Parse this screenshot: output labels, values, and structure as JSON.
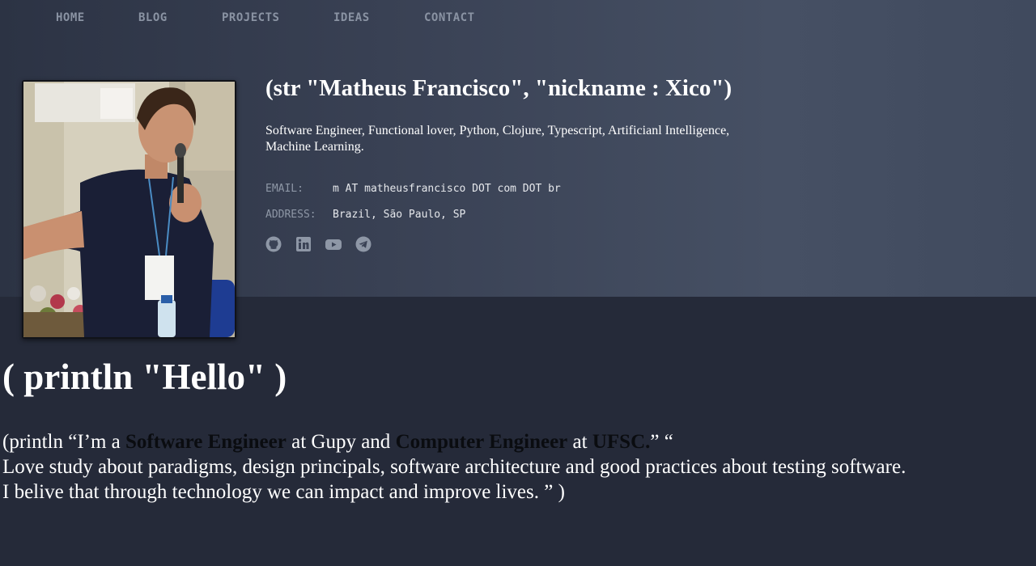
{
  "nav": {
    "items": [
      {
        "label": "HOME"
      },
      {
        "label": "BLOG"
      },
      {
        "label": "PROJECTS"
      },
      {
        "label": "IDEAS"
      },
      {
        "label": "CONTACT"
      }
    ]
  },
  "profile": {
    "name": "(str \"Matheus Francisco\", \"nickname : Xico\")",
    "tagline": "Software Engineer, Functional lover, Python, Clojure, Typescript, Artificianl Intelligence, Machine Learning.",
    "email_label": "EMAIL:",
    "email_value": "m AT matheusfrancisco DOT com DOT br",
    "address_label": "ADDRESS:",
    "address_value": "Brazil, São Paulo, SP",
    "social_icons": [
      "github-icon",
      "linkedin-icon",
      "youtube-icon",
      "telegram-icon"
    ]
  },
  "about": {
    "title": "( println \"Hello\" )",
    "line1_a": "(println “I’m a ",
    "line1_b": "Software Engineer",
    "line1_c": " at Gupy and ",
    "line1_d": "Computer Engineer",
    "line1_e": " at ",
    "line1_f": "UFSC.",
    "line1_g": "” “",
    "line2": "Love study about paradigms, design principals, software architecture and good practices about testing software.",
    "line3": "I belive that through technology we can impact and improve lives. ” )"
  },
  "colors": {
    "hero_bg": "#3a4255",
    "page_bg": "#252a39",
    "nav_text": "#8a93a3",
    "icon_gray": "#8e97a6"
  }
}
